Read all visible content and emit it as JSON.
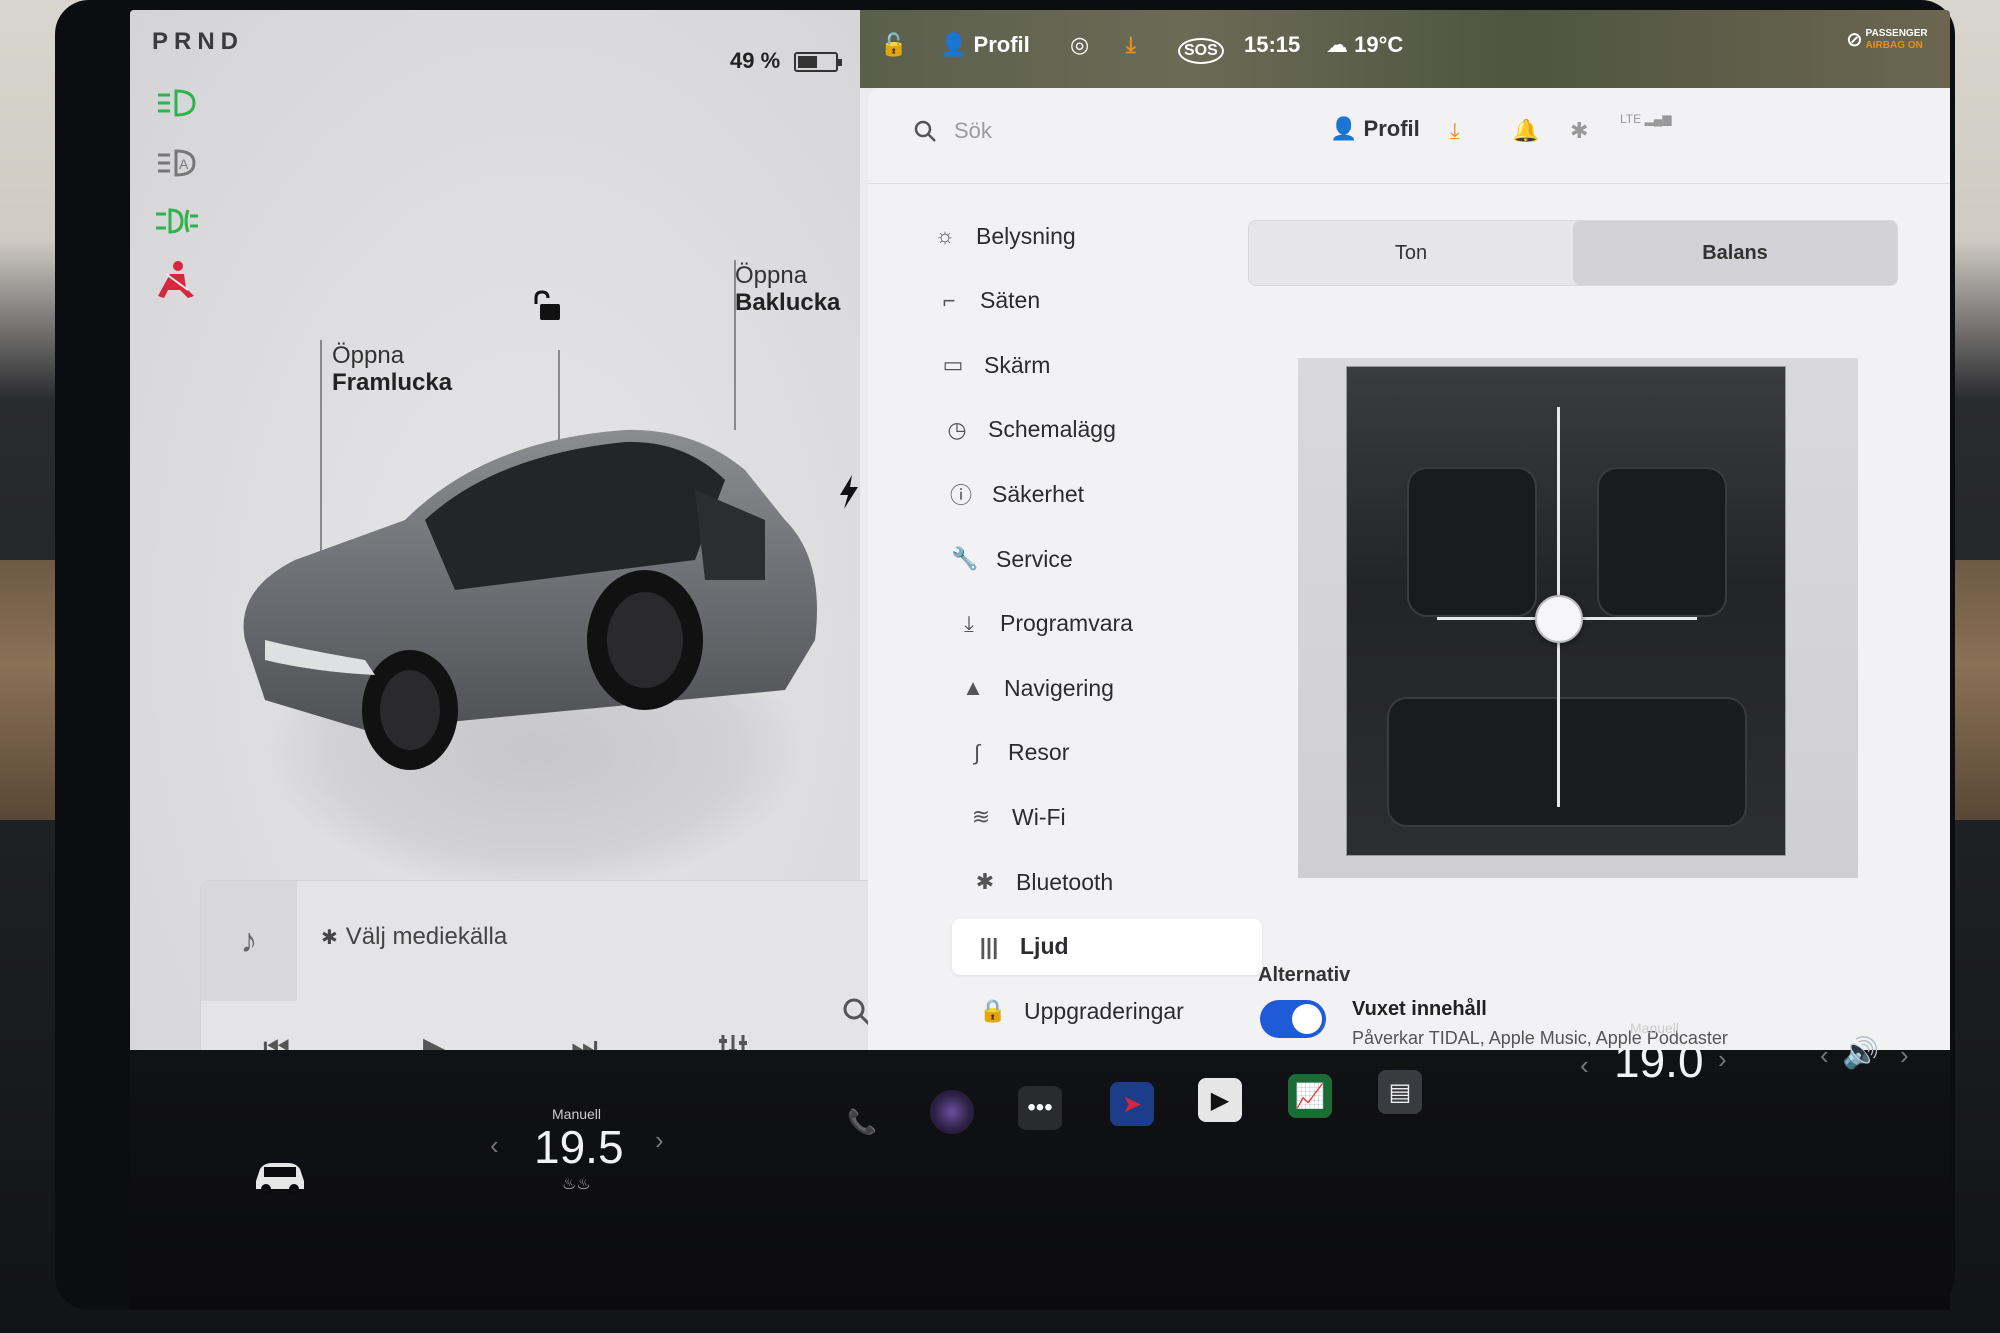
{
  "car_panel": {
    "gear": "PRND",
    "battery_percent": "49 %",
    "battery_level": 0.49,
    "frunk_label_line1": "Öppna",
    "frunk_label_line2": "Framlucka",
    "trunk_label_line1": "Öppna",
    "trunk_label_line2": "Baklucka",
    "side_icons": [
      "headlight-icon",
      "auto-headlight-icon",
      "fog-light-icon",
      "seatbelt-warning-icon"
    ]
  },
  "media": {
    "source_label": "Välj mediekälla"
  },
  "status_bar": {
    "profile": "Profil",
    "time": "15:15",
    "temperature": "19°C",
    "sos": "SOS",
    "airbag_line1": "PASSENGER",
    "airbag_line2": "AIRBAG ON"
  },
  "settings": {
    "search_placeholder": "Sök",
    "profile": "Profil",
    "lte": "LTE",
    "nav": [
      {
        "label": "Belysning",
        "icon": "sun-icon"
      },
      {
        "label": "Säten",
        "icon": "seat-icon"
      },
      {
        "label": "Skärm",
        "icon": "screen-icon"
      },
      {
        "label": "Schemalägg",
        "icon": "clock-icon"
      },
      {
        "label": "Säkerhet",
        "icon": "safety-icon"
      },
      {
        "label": "Service",
        "icon": "wrench-icon"
      },
      {
        "label": "Programvara",
        "icon": "download-icon"
      },
      {
        "label": "Navigering",
        "icon": "navigation-icon"
      },
      {
        "label": "Resor",
        "icon": "trips-icon"
      },
      {
        "label": "Wi-Fi",
        "icon": "wifi-icon"
      },
      {
        "label": "Bluetooth",
        "icon": "bluetooth-icon"
      },
      {
        "label": "Ljud",
        "icon": "equalizer-icon"
      },
      {
        "label": "Uppgraderingar",
        "icon": "lock-icon"
      }
    ],
    "active_nav": "Ljud",
    "tabs": [
      {
        "label": "Ton"
      },
      {
        "label": "Balans"
      }
    ],
    "active_tab": "Balans",
    "options_header": "Alternativ",
    "option_toggle_label": "Vuxet innehåll",
    "option_toggle_on": true,
    "option_subtext": "Påverkar TIDAL, Apple Music, Apple Podcaster"
  },
  "dock": {
    "left_mode": "Manuell",
    "left_temp": "19.5",
    "right_mode": "Manuell",
    "right_temp": "19.0",
    "apps": [
      "phone-icon",
      "camera-icon",
      "more-icon",
      "navigation-app-icon",
      "theater-icon",
      "stocks-icon",
      "toybox-icon"
    ]
  },
  "colors": {
    "accent_blue": "#1f5ad8",
    "indicator_green": "#2fb34a",
    "warning_red": "#d7263d",
    "download_orange": "#e8901a"
  }
}
